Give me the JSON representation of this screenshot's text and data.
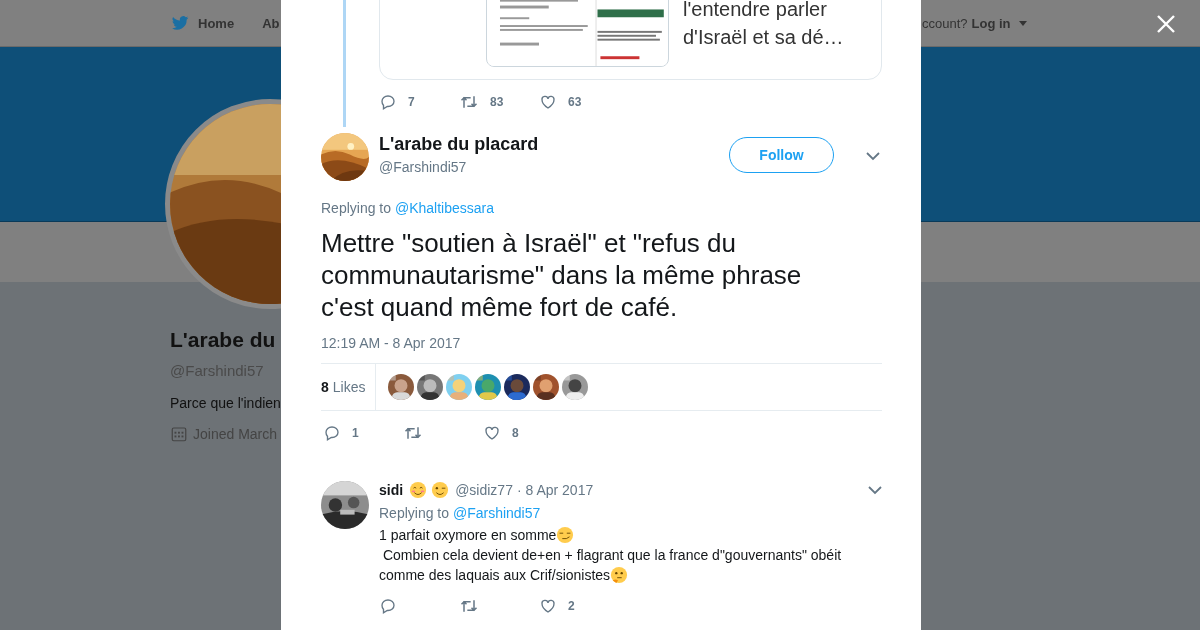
{
  "background_page": {
    "nav": [
      {
        "label": "Home",
        "kind": "home"
      },
      {
        "label": "Ab",
        "kind": "plain"
      }
    ],
    "login_prompt": "ccount?",
    "login": "Log in",
    "profile": {
      "name": "L'arabe du",
      "handle": "@Farshindi57",
      "bio": "Parce que l'indien",
      "joined": "Joined March"
    }
  },
  "modal": {
    "quoted_card": {
      "lines": [
        "l'entendre parler",
        "d'Israël et sa dé…"
      ]
    },
    "parent_actions": {
      "replies": "7",
      "retweets": "83",
      "likes": "63"
    },
    "tweet": {
      "name": "L'arabe du placard",
      "handle": "@Farshindi57",
      "follow": "Follow",
      "replying_label": "Replying to",
      "replying_to": "@Khaltibessara",
      "text": "Mettre \"soutien à Israël\" et \"refus du communautarisme\" dans la même phrase c'est quand même fort de café.",
      "timestamp": "12:19 AM - 8 Apr 2017",
      "likes_count": "8",
      "likes_label": "Likes",
      "actions": {
        "replies": "1",
        "likes": "8"
      }
    },
    "replies": [
      {
        "name": "sidi",
        "name_emojis": [
          {
            "kind": "smiling"
          },
          {
            "kind": "winking"
          }
        ],
        "handle": "@sidiz77",
        "date": "· 8 Apr 2017",
        "replying_label": "Replying to",
        "replying_to": "@Farshindi57",
        "lines": [
          {
            "kind": "smirking",
            "text": "1 parfait oxymore en somme"
          },
          {
            "kind": "plain",
            "text": " Combien cela devient de+en + flagrant que la france d\"gouvernants\" obéit"
          },
          {
            "kind": "thinking",
            "text": "comme des laquais aux Crif/sionistes"
          }
        ],
        "likes": "2"
      }
    ]
  }
}
